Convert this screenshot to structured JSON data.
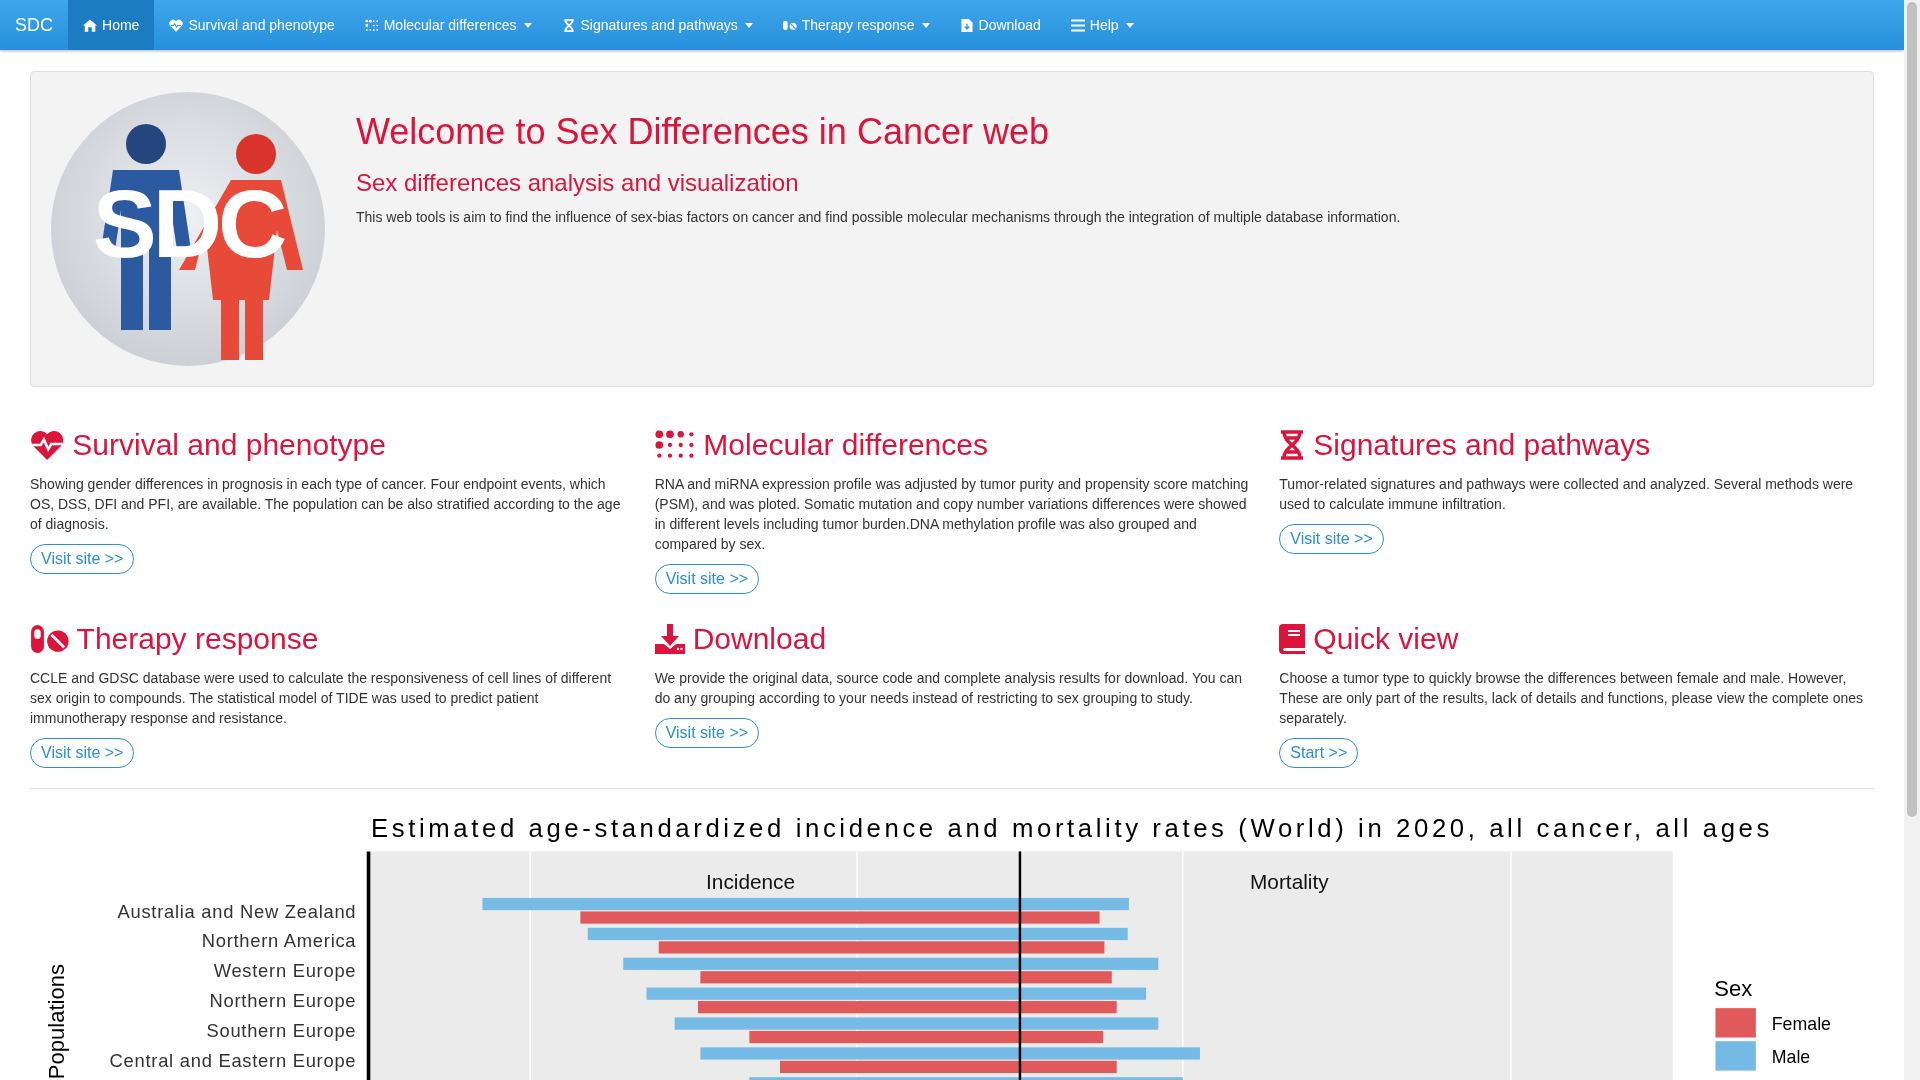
{
  "navbar": {
    "brand": "SDC",
    "items": [
      {
        "label": "Home",
        "selected": true,
        "dropdown": false
      },
      {
        "label": "Survival and phenotype",
        "selected": false,
        "dropdown": false
      },
      {
        "label": "Molecular differences",
        "selected": false,
        "dropdown": true
      },
      {
        "label": "Signatures and pathways",
        "selected": false,
        "dropdown": true
      },
      {
        "label": "Therapy response",
        "selected": false,
        "dropdown": true
      },
      {
        "label": "Download",
        "selected": false,
        "dropdown": false
      },
      {
        "label": "Help",
        "selected": false,
        "dropdown": true
      }
    ]
  },
  "hero": {
    "logo_text": "SDC",
    "title": "Welcome to Sex Differences in Cancer web",
    "subtitle": "Sex differences analysis and visualization",
    "text": "This web tools is aim to find the influence of sex-bias factors on cancer and find possible molecular mechanisms through the integration of multiple database information."
  },
  "sections": [
    {
      "title": "Survival and phenotype",
      "text": "Showing gender differences in prognosis in each type of cancer. Four endpoint events, which OS, DSS, DFI and PFI, are available. The population can be also stratified according to the age of diagnosis.",
      "button": "Visit site >>"
    },
    {
      "title": "Molecular differences",
      "text": "RNA and miRNA expression profile was adjusted by tumor purity and propensity score matching (PSM), and was ploted. Somatic mutation and copy number variations differences were showed in different levels including tumor burden.DNA methylation profile was also grouped and compared by sex.",
      "button": "Visit site >>"
    },
    {
      "title": "Signatures and pathways",
      "text": "Tumor-related signatures and pathways were collected and analyzed. Several methods were used to calculate immune infiltration.",
      "button": "Visit site >>"
    },
    {
      "title": "Therapy response",
      "text": "CCLE and GDSC database were used to calculate the responsiveness of cell lines of different sex origin to compounds. The statistical model of TIDE was used to predict patient immunotherapy response and resistance.",
      "button": "Visit site >>"
    },
    {
      "title": "Download",
      "text": "We provide the original data, source code and complete analysis results for download. You can do any grouping according to your needs instead of restricting to sex grouping to study.",
      "button": "Visit site >>"
    },
    {
      "title": "Quick view",
      "text": "Choose a tumor type to quickly browse the differences between female and male. However, These are only part of the results, lack of details and functions, please view the complete ones separately.",
      "button": "Start >>"
    }
  ],
  "figure": {
    "title": "Estimated age-standardized incidence and mortality rates (World) in 2020, all cancer, all ages",
    "panels": [
      "Incidence",
      "Mortality"
    ],
    "ylabel": "Populations",
    "populations": [
      "Australia and New Zealand",
      "Northern America",
      "Western Europe",
      "Northern Europe",
      "Southern Europe",
      "Central and Eastern Europe"
    ],
    "legend": {
      "title": "Sex",
      "items": [
        {
          "label": "Female",
          "color": "#e05a5c"
        },
        {
          "label": "Male",
          "color": "#76bbe5"
        }
      ]
    }
  }
}
